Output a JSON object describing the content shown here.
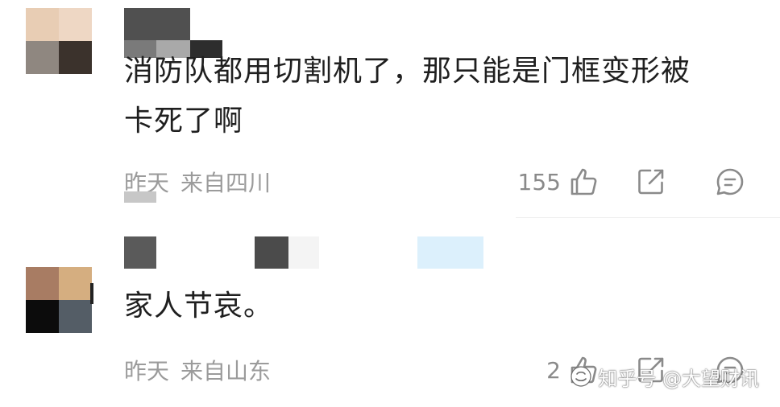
{
  "comments": [
    {
      "text_line1": "消防队都用切割机了，那只能是门框变形被",
      "text_line2": "卡死了啊",
      "time": "昨天",
      "location": "来自四川",
      "likes": "155"
    },
    {
      "text_line1": "家人节哀。",
      "time": "昨天",
      "location": "来自山东",
      "likes": "2"
    }
  ],
  "icons": {
    "like": "thumbs-up-icon",
    "share": "share-icon",
    "reply": "reply-bubble-icon"
  },
  "watermark": {
    "text": "知乎号 @大望财讯"
  },
  "colors": {
    "text": "#1f1f1f",
    "meta": "#9b9b9b",
    "icon": "#8a8a8a"
  }
}
